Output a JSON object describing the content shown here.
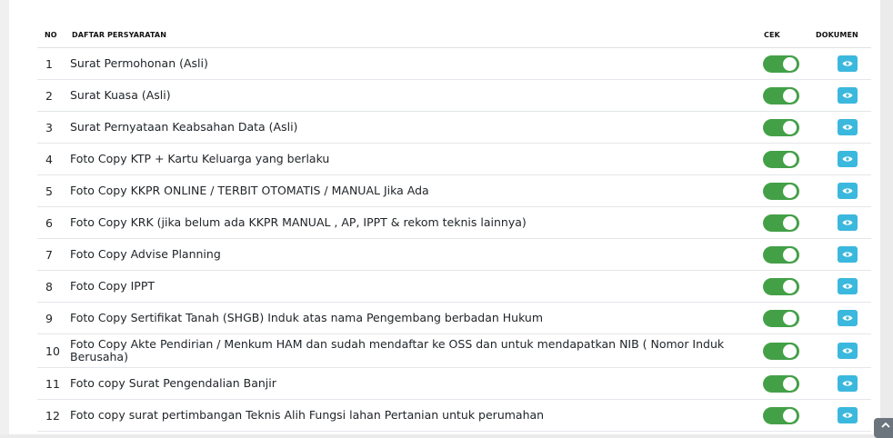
{
  "table": {
    "headers": {
      "no": "NO",
      "name": "DAFTAR PERSYARATAN",
      "check": "CEK",
      "document": "DOKUMEN"
    },
    "rows": [
      {
        "no": "1",
        "name": "Surat Permohonan (Asli)",
        "checked": true
      },
      {
        "no": "2",
        "name": "Surat Kuasa (Asli)",
        "checked": true
      },
      {
        "no": "3",
        "name": "Surat Pernyataan Keabsahan Data (Asli)",
        "checked": true
      },
      {
        "no": "4",
        "name": "Foto Copy KTP + Kartu Keluarga yang berlaku",
        "checked": true
      },
      {
        "no": "5",
        "name": "Foto Copy KKPR ONLINE / TERBIT OTOMATIS / MANUAL Jika Ada",
        "checked": true
      },
      {
        "no": "6",
        "name": "Foto Copy KRK (jika belum ada KKPR MANUAL , AP, IPPT & rekom teknis lainnya)",
        "checked": true
      },
      {
        "no": "7",
        "name": "Foto Copy Advise Planning",
        "checked": true
      },
      {
        "no": "8",
        "name": "Foto Copy IPPT",
        "checked": true
      },
      {
        "no": "9",
        "name": "Foto Copy Sertifikat Tanah (SHGB) Induk atas nama Pengembang berbadan Hukum",
        "checked": true
      },
      {
        "no": "10",
        "name": "Foto Copy Akte Pendirian / Menkum HAM dan sudah mendaftar ke OSS dan untuk mendapatkan NIB ( Nomor Induk Berusaha)",
        "checked": true
      },
      {
        "no": "11",
        "name": "Foto copy Surat Pengendalian Banjir",
        "checked": true
      },
      {
        "no": "12",
        "name": "Foto copy surat pertimbangan Teknis Alih Fungsi lahan Pertanian untuk perumahan",
        "checked": true
      }
    ]
  },
  "colors": {
    "toggle_on": "#43a047",
    "view_button": "#3bb8dd",
    "scroll_top": "#6c757d"
  },
  "icons": {
    "view": "eye-icon",
    "scroll_top": "chevron-up-icon"
  }
}
